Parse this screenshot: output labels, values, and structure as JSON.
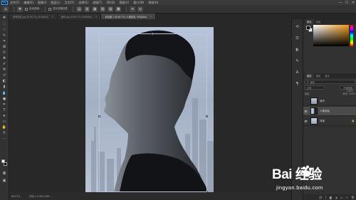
{
  "app": {
    "logo": "Ps"
  },
  "menu": {
    "items": [
      "文件(F)",
      "编辑(E)",
      "图像(I)",
      "图层(L)",
      "文字(Y)",
      "选择(S)",
      "滤镜(T)",
      "3D(D)",
      "视图(V)",
      "窗口(W)",
      "帮助(H)"
    ],
    "window_controls": [
      "—",
      "☐",
      "✕"
    ]
  },
  "options_bar": {
    "icons": [
      "move-icon",
      "arrange-icon"
    ],
    "auto_select_label": "自动选择:",
    "show_transform_label": "显示变换控件"
  },
  "tabs": [
    {
      "label": "帅哥剪影.jpg @ 66.7% (RGB/8#)",
      "active": false,
      "close": "×"
    },
    {
      "label": "城市.jpg @ 66.7% (RGB/8#)",
      "active": false,
      "close": "×"
    },
    {
      "label": "未标题-1 @ 66.7% (人像剪影, RGB/8#)",
      "active": true,
      "close": "×"
    }
  ],
  "status_bar": {
    "zoom": "66.67%",
    "doc_info": "文档:2.41M/4.58M"
  },
  "panels": {
    "color_tabs": [
      "颜色",
      "色板"
    ],
    "layers_tabs": [
      "图层",
      "通道",
      "路径"
    ],
    "kind_filter": "类型",
    "blend_mode": "正常",
    "opacity_label": "不透明度: 100%",
    "lock_label": "锁定:",
    "fill_label": "填充: 100%",
    "layers": [
      {
        "name": "背景",
        "visible": true,
        "selected": false
      },
      {
        "name": "人像剪影",
        "visible": true,
        "selected": true
      },
      {
        "name": "城市",
        "visible": false,
        "selected": false
      }
    ],
    "footer_icons": [
      "link-icon",
      "fx-icon",
      "mask-icon",
      "adjust-icon",
      "folder-icon",
      "new-layer-icon",
      "trash-icon"
    ]
  },
  "watermark": {
    "title": "Bai 经验",
    "subtitle": "jingyan.baidu.com"
  },
  "colors": {
    "ui_dark": "#323232",
    "canvas_bg": "#282828",
    "accent": "#31a8ff"
  }
}
